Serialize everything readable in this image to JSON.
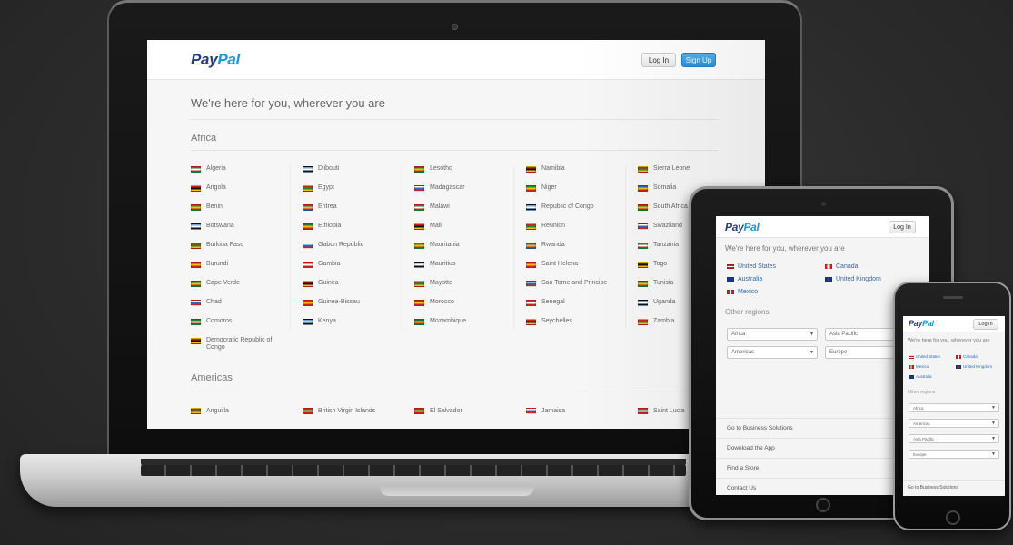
{
  "brand": {
    "pay": "Pay",
    "pal": "Pal"
  },
  "laptop": {
    "login_label": "Log In",
    "signup_label": "Sign Up",
    "title": "We're here for you, wherever you are",
    "regions": {
      "africa": "Africa",
      "americas": "Americas"
    },
    "africa_columns": [
      [
        "Algeria",
        "Angola",
        "Benin",
        "Botswana",
        "Burkina Faso",
        "Burundi",
        "Cape Verde",
        "Chad",
        "Comoros",
        "Democratic Republic of Congo"
      ],
      [
        "Djibouti",
        "Egypt",
        "Eritrea",
        "Ethiopia",
        "Gabon Republic",
        "Gambia",
        "Guinea",
        "Guinea-Bissau",
        "Kenya"
      ],
      [
        "Lesotho",
        "Madagascar",
        "Malawi",
        "Mali",
        "Mauritania",
        "Mauritius",
        "Mayotte",
        "Morocco",
        "Mozambique"
      ],
      [
        "Namibia",
        "Niger",
        "Republic of Congo",
        "Reunion",
        "Rwanda",
        "Saint Helena",
        "Sao Tome and Principe",
        "Senegal",
        "Seychelles"
      ],
      [
        "Sierra Leone",
        "Somalia",
        "South Africa",
        "Swaziland",
        "Tanzania",
        "Togo",
        "Tunisia",
        "Uganda",
        "Zambia"
      ]
    ],
    "americas_row": [
      "Anguilla",
      "British Virgin Islands",
      "El Salvador",
      "Jamaica",
      "Saint Lucia"
    ]
  },
  "tablet": {
    "login_label": "Log In",
    "title": "We're here for you, wherever you are",
    "countries": [
      "United States",
      "Canada",
      "Australia",
      "United Kingdom",
      "Mexico"
    ],
    "other_regions_label": "Other regions",
    "selects": [
      "Africa",
      "Asia Pacific",
      "Americas",
      "Europe"
    ],
    "footer_links": [
      "Go to Business Solutions",
      "Download the App",
      "Find a Store",
      "Contact Us"
    ]
  },
  "phone": {
    "login_label": "Log In",
    "title": "We're here for you, wherever you are",
    "countries": [
      "United States",
      "Canada",
      "Mexico",
      "United Kingdom",
      "Australia"
    ],
    "other_regions_label": "Other regions",
    "selects": [
      "Africa",
      "Americas",
      "Asia Pacific",
      "Europe"
    ],
    "footer_link": "Go to Business Solutions"
  },
  "colors": {
    "brand_dark": "#253b80",
    "brand_light": "#179bd7",
    "signup_blue": "#2d8fd6",
    "link_blue": "#2a6bb5"
  }
}
